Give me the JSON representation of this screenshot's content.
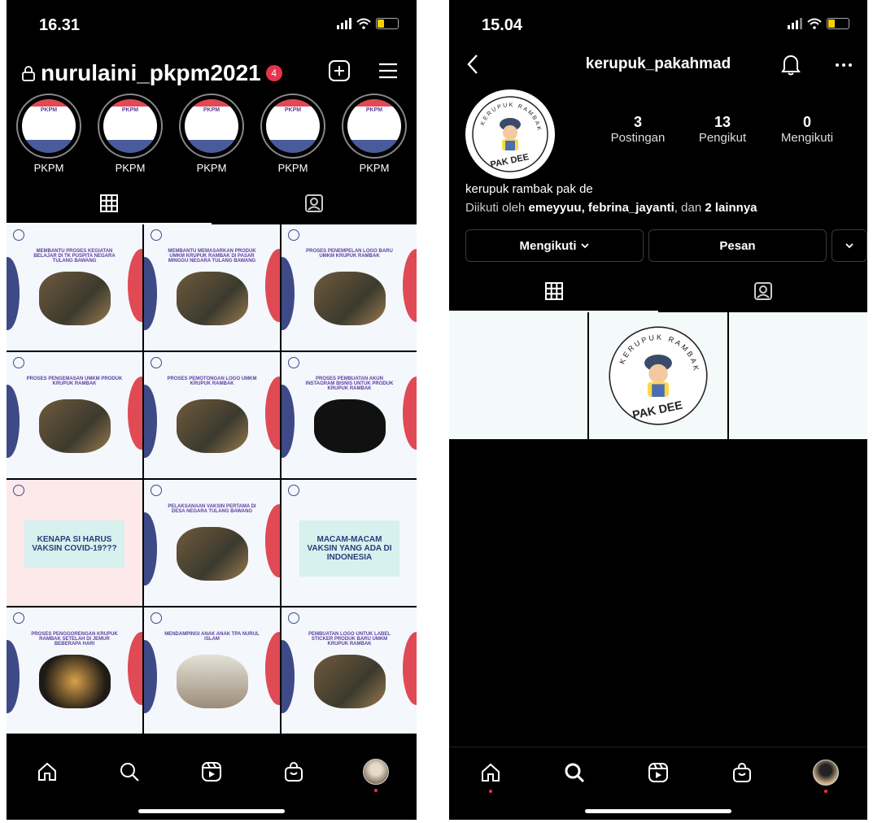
{
  "left": {
    "status": {
      "time": "16.31"
    },
    "header": {
      "username": "nurulaini_pkpm2021",
      "notifications": "4"
    },
    "highlights": [
      {
        "label": "PKPM",
        "cover": "PKPM"
      },
      {
        "label": "PKPM",
        "cover": "PKPM"
      },
      {
        "label": "PKPM",
        "cover": "PKPM"
      },
      {
        "label": "PKPM",
        "cover": "PKPM"
      },
      {
        "label": "PKPM",
        "cover": "PKPM"
      }
    ],
    "posts": [
      {
        "title": "MEMBANTU PROSES KEGIATAN BELAJAR DI TK PUSPITA NEGARA TULANG BAWANG"
      },
      {
        "title": "MEMBANTU MEMASARKAN PRODUK UMKM KRUPUK RAMBAK DI PASAR MINGGU NEGARA TULANG BAWANG"
      },
      {
        "title": "PROSES PENEMPELAN LOGO BARU UMKM KRUPUK RAMBAK"
      },
      {
        "title": "PROSES PENGEMASAN UMKM PRODUK KRUPUK RAMBAK"
      },
      {
        "title": "PROSES PEMOTONGAN LOGO UMKM KRUPUK RAMBAK"
      },
      {
        "title": "PROSES PEMBUATAN AKUN INSTAGRAM BISNIS UNTUK PRODUK KRUPUK RAMBAK"
      },
      {
        "title": "KENAPA SI HARUS VAKSIN COVID-19???"
      },
      {
        "title": "PELAKSANAAN VAKSIN PERTAMA DI DESA NEGARA TULANG BAWANG"
      },
      {
        "title": "MACAM-MACAM VAKSIN YANG ADA DI INDONESIA"
      },
      {
        "title": "PROSES PENGGORENGAN KRUPUK RAMBAK SETELAH DI JEMUR BEBERAPA HARI"
      },
      {
        "title": "MENDAMPINGI ANAK ANAK TPA NURUL ISLAM"
      },
      {
        "title": "PEMBUATAN LOGO UNTUK LABEL STICKER PRODUK BARU UMKM KRUPUK RAMBAK"
      }
    ]
  },
  "right": {
    "status": {
      "time": "15.04"
    },
    "header": {
      "username": "kerupuk_pakahmad"
    },
    "profile": {
      "logo_arc": "KERUPUK RAMBAK",
      "logo_name": "PAK DEE",
      "stats": [
        {
          "value": "3",
          "label": "Postingan"
        },
        {
          "value": "13",
          "label": "Pengikut"
        },
        {
          "value": "0",
          "label": "Mengikuti"
        }
      ],
      "bio": "kerupuk rambak pak de",
      "followed_prefix": "Diikuti oleh ",
      "followed_users": "emeyyuu, febrina_jayanti",
      "followed_mid": ", dan ",
      "followed_more": "2 lainnya"
    },
    "buttons": {
      "following": "Mengikuti",
      "message": "Pesan"
    }
  },
  "colors": {
    "accent": "#e8334a",
    "battery": "#f5d000",
    "post_blue": "#3e4a86",
    "post_red": "#e04a55"
  }
}
